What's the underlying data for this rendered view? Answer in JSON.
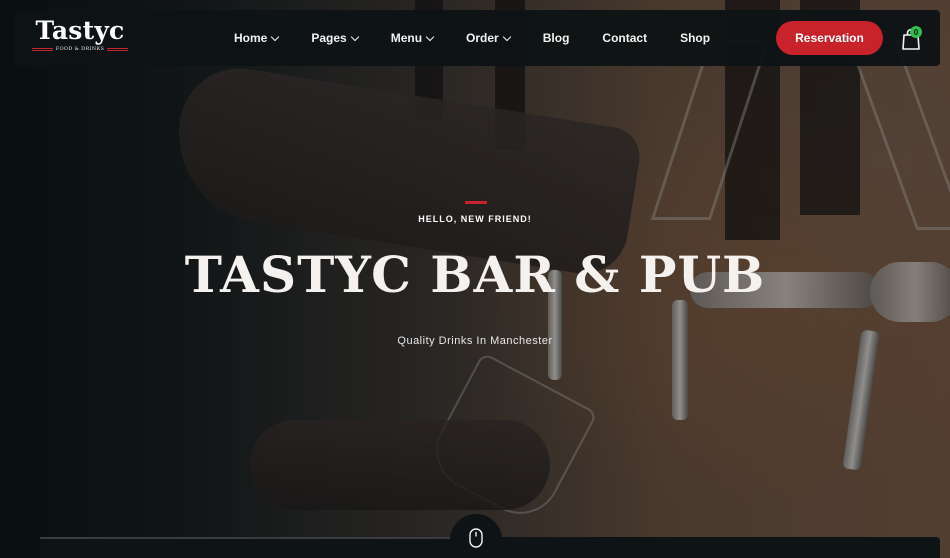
{
  "brand": {
    "name": "Tastyc",
    "tagline": "FOOD & DRINKS",
    "accent_color": "#c8222b"
  },
  "nav": {
    "items": [
      {
        "label": "Home",
        "has_dropdown": true
      },
      {
        "label": "Pages",
        "has_dropdown": true
      },
      {
        "label": "Menu",
        "has_dropdown": true
      },
      {
        "label": "Order",
        "has_dropdown": true
      },
      {
        "label": "Blog",
        "has_dropdown": false
      },
      {
        "label": "Contact",
        "has_dropdown": false
      },
      {
        "label": "Shop",
        "has_dropdown": false
      }
    ],
    "reservation_label": "Reservation",
    "cart_count": "0",
    "cart_icon": "shopping-bag-icon"
  },
  "hero": {
    "eyebrow": "HELLO, NEW FRIEND!",
    "headline": "TASTYC BAR & PUB",
    "subline": "Quality Drinks In Manchester",
    "scroll_icon": "mouse-scroll-icon"
  }
}
